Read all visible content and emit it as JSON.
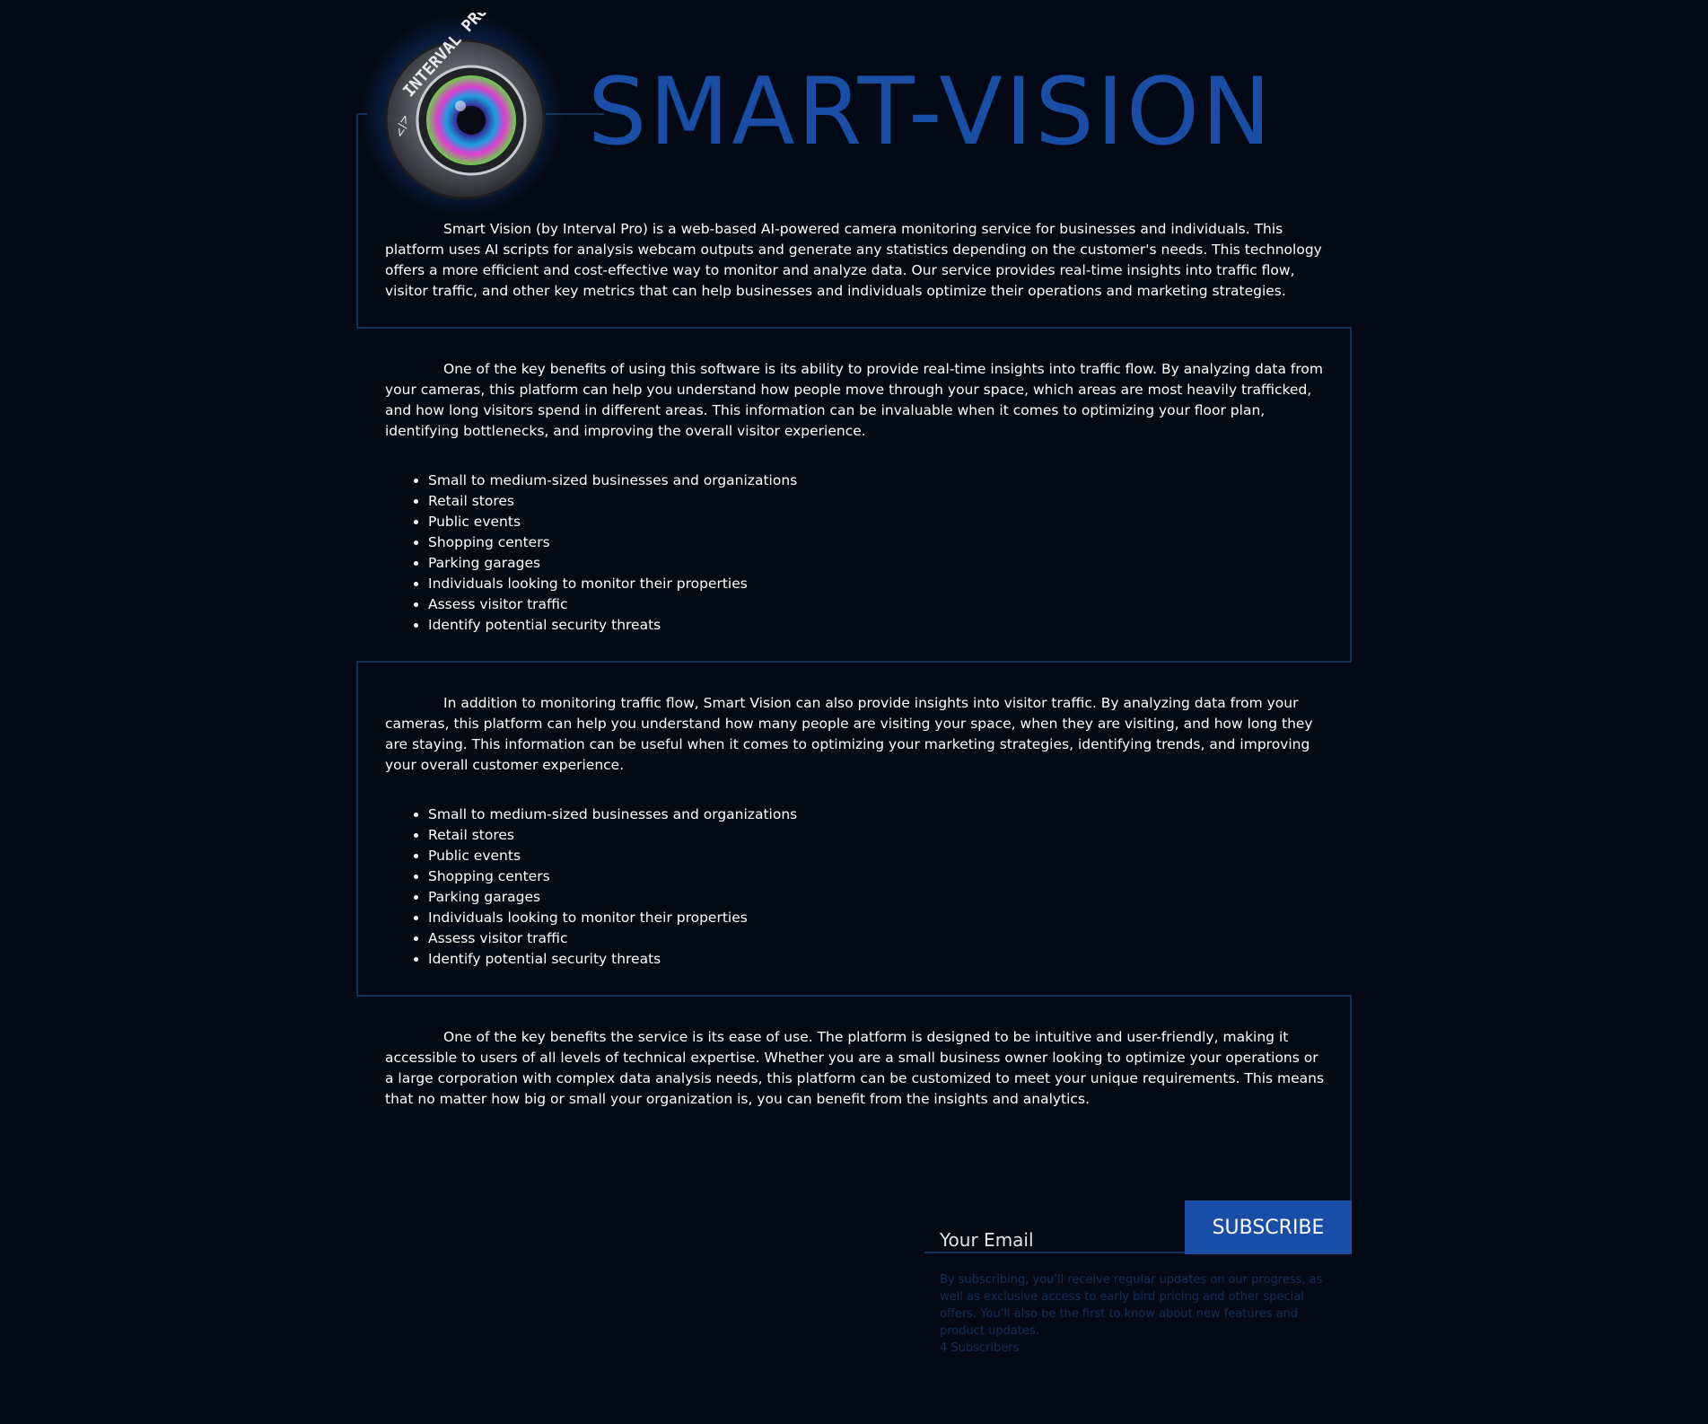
{
  "brand": {
    "title": "SMART-VISION",
    "logo_text": "INTERVAL PRO",
    "logo_code": "</>"
  },
  "colors": {
    "background": "#030a15",
    "accent": "#1a4ea6",
    "frame": "#133055",
    "note": "#132f58"
  },
  "sections": [
    {
      "paragraph": "Smart Vision (by Interval Pro) is a web-based AI-powered camera monitoring service for businesses and individuals. This platform uses AI scripts for analysis webcam outputs and generate any statistics depending on the customer's needs. This technology offers a more efficient and cost-effective way to monitor and analyze data. Our service provides real-time insights into traffic flow, visitor traffic, and other key metrics that can help businesses and individuals optimize their operations and marketing strategies."
    },
    {
      "paragraph": "One of the key benefits of using this software is its ability to provide real-time insights into traffic flow. By analyzing data from your cameras, this platform can help you understand how people move through your space, which areas are most heavily trafficked, and how long visitors spend in different areas. This information can be invaluable when it comes to optimizing your floor plan, identifying bottlenecks, and improving the overall visitor experience.",
      "list": [
        "Small to medium-sized businesses and organizations",
        "Retail stores",
        "Public events",
        "Shopping centers",
        "Parking garages",
        "Individuals looking to monitor their properties",
        "Assess visitor traffic",
        "Identify potential security threats"
      ]
    },
    {
      "paragraph": "In addition to monitoring traffic flow, Smart Vision can also provide insights into visitor traffic. By analyzing data from your cameras, this platform can help you understand how many people are visiting your space, when they are visiting, and how long they are staying. This information can be useful when it comes to optimizing your marketing strategies, identifying trends, and improving your overall customer experience.",
      "list": [
        "Small to medium-sized businesses and organizations",
        "Retail stores",
        "Public events",
        "Shopping centers",
        "Parking garages",
        "Individuals looking to monitor their properties",
        "Assess visitor traffic",
        "Identify potential security threats"
      ]
    },
    {
      "paragraph": "One of the key benefits the service is its ease of use. The platform is designed to be intuitive and user-friendly, making it accessible to users of all levels of technical expertise. Whether you are a small business owner looking to optimize your operations or a large corporation with complex data analysis needs, this platform can be customized to meet your unique requirements. This means that no matter how big or small your organization is, you can benefit from the insights and analytics."
    }
  ],
  "subscribe": {
    "email_placeholder": "Your Email",
    "button_label": "SUBSCRIBE",
    "note": "By subscribing, you'll receive regular updates on our progress, as well as exclusive access to early bird pricing and other special offers. You'll also be the first to know about new features and product updates.",
    "subscribers": "4 Subscribers"
  }
}
